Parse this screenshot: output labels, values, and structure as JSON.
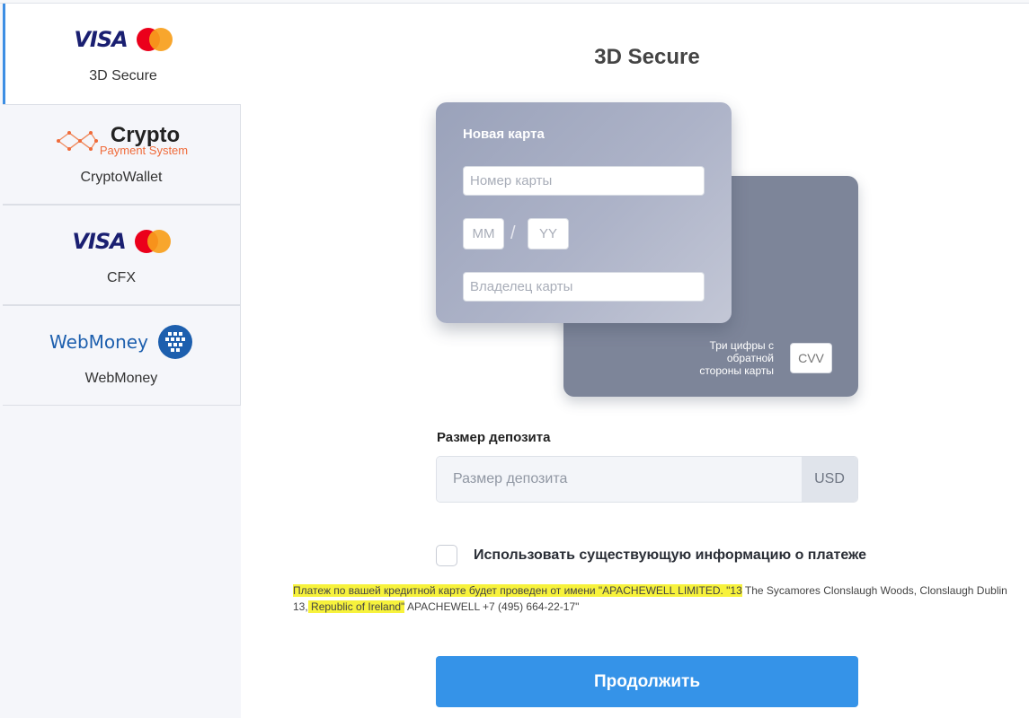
{
  "sidebar": {
    "methods": [
      {
        "label": "3D Secure",
        "logo": "visa-mastercard",
        "active": true
      },
      {
        "label": "CryptoWallet",
        "logo": "crypto-payment-system",
        "logo_title": "Crypto",
        "logo_subtitle": "Payment System",
        "active": false
      },
      {
        "label": "CFX",
        "logo": "visa-mastercard",
        "active": false
      },
      {
        "label": "WebMoney",
        "logo": "webmoney",
        "logo_title": "WebMoney",
        "active": false
      }
    ],
    "visa_text": "VISA"
  },
  "main": {
    "title": "3D Secure",
    "card_front": {
      "heading": "Новая карта",
      "number_placeholder": "Номер карты",
      "mm_placeholder": "MM",
      "yy_placeholder": "YY",
      "date_separator": "/",
      "holder_placeholder": "Владелец карты"
    },
    "card_back": {
      "cvv_hint": "Три цифры с обратной стороны карты",
      "cvv_placeholder": "CVV"
    },
    "deposit": {
      "label": "Размер депозита",
      "placeholder": "Размер депозита",
      "currency": "USD"
    },
    "saved_info": {
      "label": "Использовать существующую информацию о платеже",
      "checked": false
    },
    "disclaimer": {
      "highlighted_1": "Платеж по вашей кредитной карте будет проведен от имени \"APACHEWELL LIMITED. \"13",
      "plain_1": " The Sycamores Clonslaugh Woods, Clonslaugh Dublin 13,",
      "highlighted_2": " Republic of Ireland\"",
      "plain_2": " APACHEWELL +7 (495) 664-22-17\""
    },
    "submit_label": "Продолжить"
  },
  "colors": {
    "accent": "#3593e8",
    "active_border": "#3d8ee3",
    "highlight": "#f7f23c"
  }
}
